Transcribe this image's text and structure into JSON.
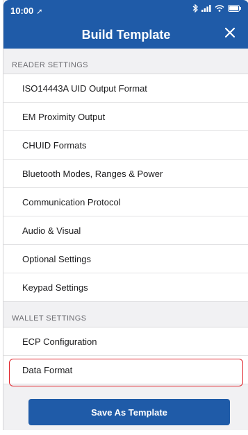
{
  "status_bar": {
    "time": "10:00",
    "location_glyph": "➚",
    "icons": [
      "bluetooth-icon",
      "signal-icon",
      "wifi-icon",
      "battery-icon"
    ]
  },
  "nav": {
    "title": "Build Template",
    "close_icon": "close-icon"
  },
  "reader_settings": {
    "header": "READER SETTINGS",
    "items": [
      {
        "label": "ISO14443A UID Output Format"
      },
      {
        "label": "EM Proximity Output"
      },
      {
        "label": "CHUID Formats"
      },
      {
        "label": "Bluetooth Modes, Ranges & Power"
      },
      {
        "label": "Communication Protocol"
      },
      {
        "label": "Audio & Visual"
      },
      {
        "label": "Optional Settings"
      },
      {
        "label": "Keypad Settings"
      }
    ]
  },
  "wallet_settings": {
    "header": "WALLET SETTINGS",
    "items": [
      {
        "label": "ECP Configuration"
      },
      {
        "label": "Data Format"
      }
    ]
  },
  "footer": {
    "save_label": "Save As Template"
  },
  "colors": {
    "brand_blue": "#1f5ba8",
    "highlight_red": "#e0232a",
    "background": "#f1f1f3"
  }
}
